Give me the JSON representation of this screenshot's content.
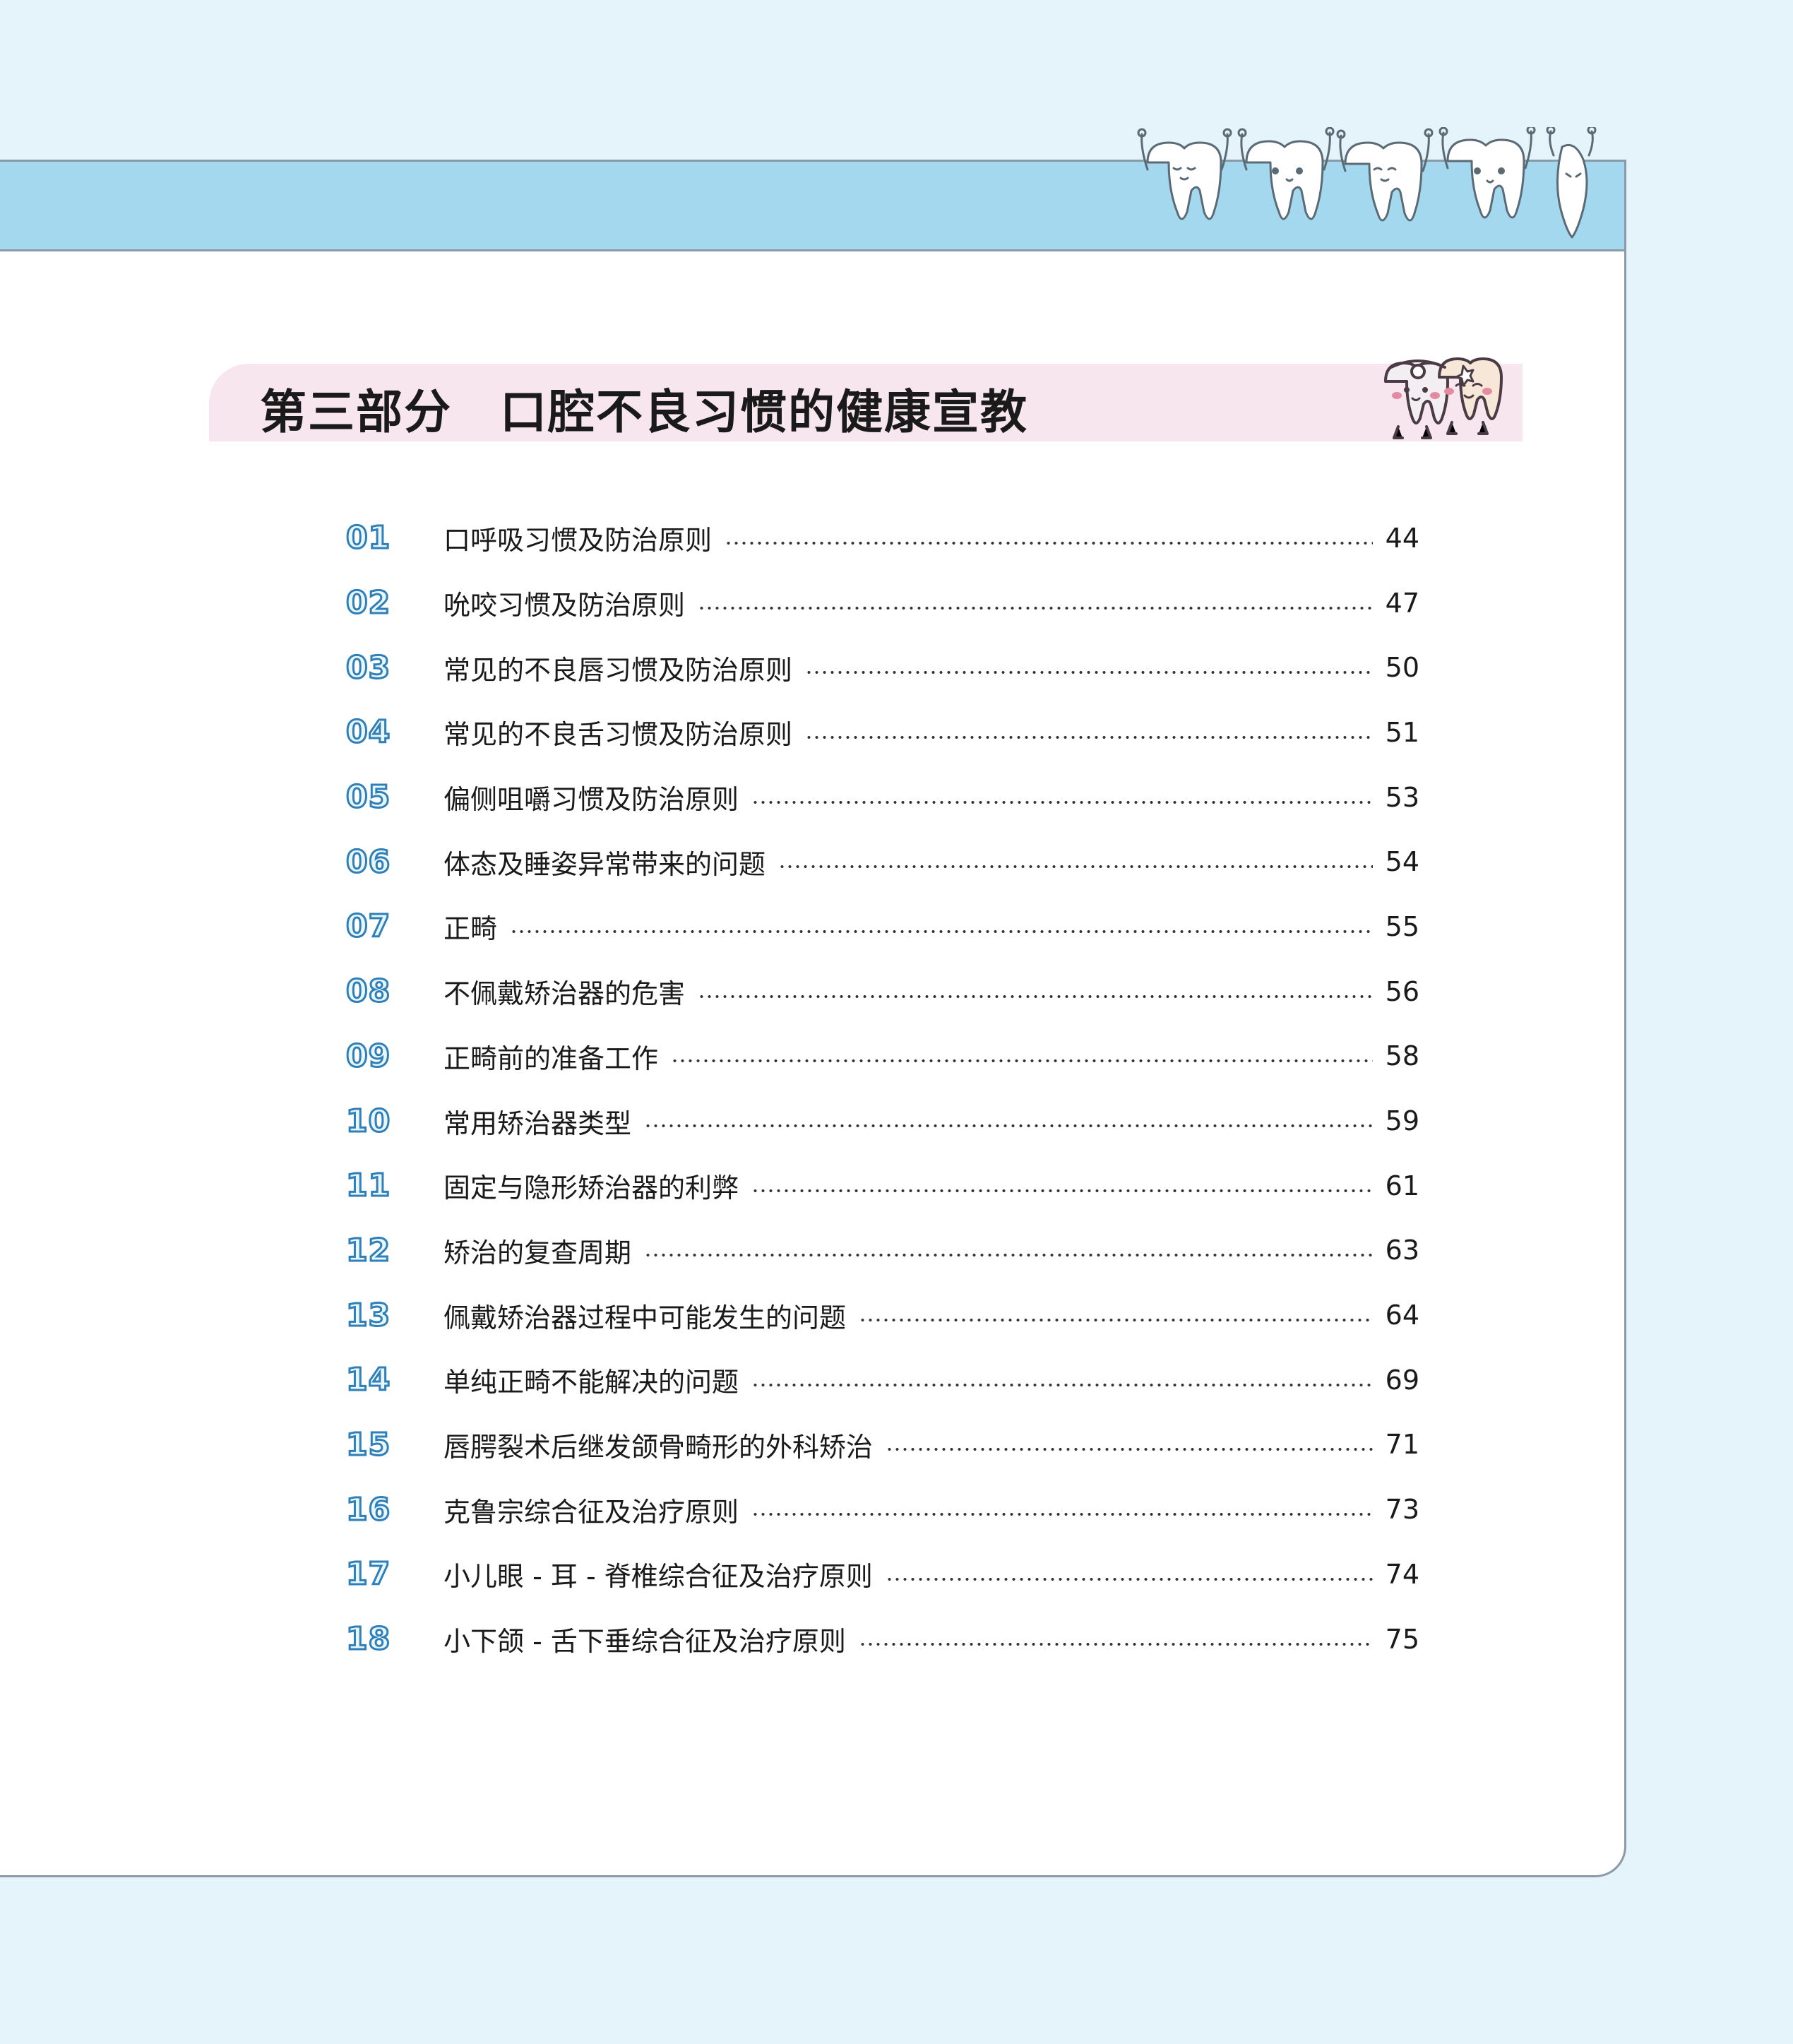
{
  "section_title": "第三部分　口腔不良习惯的健康宣教",
  "toc": [
    {
      "num": "01",
      "title": "口呼吸习惯及防治原则",
      "page": "44"
    },
    {
      "num": "02",
      "title": "吮咬习惯及防治原则",
      "page": "47"
    },
    {
      "num": "03",
      "title": "常见的不良唇习惯及防治原则",
      "page": "50"
    },
    {
      "num": "04",
      "title": "常见的不良舌习惯及防治原则",
      "page": "51"
    },
    {
      "num": "05",
      "title": "偏侧咀嚼习惯及防治原则",
      "page": "53"
    },
    {
      "num": "06",
      "title": "体态及睡姿异常带来的问题",
      "page": "54"
    },
    {
      "num": "07",
      "title": "正畸",
      "page": "55"
    },
    {
      "num": "08",
      "title": "不佩戴矫治器的危害",
      "page": "56"
    },
    {
      "num": "09",
      "title": "正畸前的准备工作",
      "page": "58"
    },
    {
      "num": "10",
      "title": "常用矫治器类型",
      "page": "59"
    },
    {
      "num": "11",
      "title": "固定与隐形矫治器的利弊",
      "page": "61"
    },
    {
      "num": "12",
      "title": "矫治的复查周期",
      "page": "63"
    },
    {
      "num": "13",
      "title": "佩戴矫治器过程中可能发生的问题",
      "page": "64"
    },
    {
      "num": "14",
      "title": "单纯正畸不能解决的问题",
      "page": "69"
    },
    {
      "num": "15",
      "title": "唇腭裂术后继发颌骨畸形的外科矫治",
      "page": "71"
    },
    {
      "num": "16",
      "title": "克鲁宗综合征及治疗原则",
      "page": "73"
    },
    {
      "num": "17",
      "title": "小儿眼 - 耳 - 脊椎综合征及治疗原则",
      "page": "74"
    },
    {
      "num": "18",
      "title": "小下颌 - 舌下垂综合征及治疗原则",
      "page": "75"
    }
  ],
  "colors": {
    "background": "#e5f3fb",
    "header_band": "#a3d8ee",
    "title_banner": "#f7e6ee",
    "number_outline": "#2f7fb8"
  },
  "icons": {
    "header_decoration": "cartoon-teeth-row",
    "title_decoration": "tooth-mascots-icon"
  }
}
